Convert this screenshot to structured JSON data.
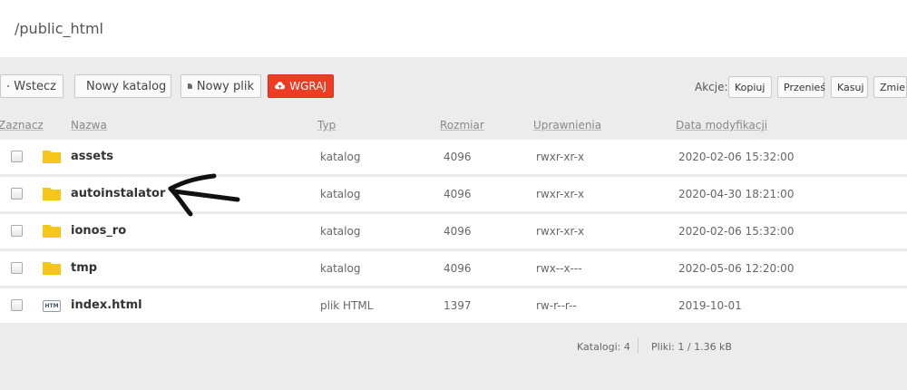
{
  "path": "/public_html",
  "toolbar": {
    "back_label": "Wstecz",
    "new_folder_label": "Nowy katalog",
    "new_file_label": "Nowy plik",
    "upload_label": "WGRAJ",
    "actions_label": "Akcje:",
    "copy_label": "Kopiuj",
    "move_label": "Przenieś",
    "delete_label": "Kasuj",
    "change_label": "Zmien"
  },
  "columns": {
    "select": "Zaznacz",
    "name": "Nazwa",
    "type": "Typ",
    "size": "Rozmiar",
    "perms": "Uprawnienia",
    "modified": "Data modyfikacji"
  },
  "files": [
    {
      "name": "assets",
      "type": "katalog",
      "size": "4096",
      "perms": "rwxr-xr-x",
      "modified": "2020-02-06 15:32:00",
      "icon": "folder-icon"
    },
    {
      "name": "autoinstalator",
      "type": "katalog",
      "size": "4096",
      "perms": "rwxr-xr-x",
      "modified": "2020-04-30 18:21:00",
      "icon": "folder-icon"
    },
    {
      "name": "ionos_ro",
      "type": "katalog",
      "size": "4096",
      "perms": "rwxr-xr-x",
      "modified": "2020-02-06 15:32:00",
      "icon": "folder-icon"
    },
    {
      "name": "tmp",
      "type": "katalog",
      "size": "4096",
      "perms": "rwx--x---",
      "modified": "2020-05-06 12:20:00",
      "icon": "folder-icon"
    },
    {
      "name": "index.html",
      "type": "plik HTML",
      "size": "1397",
      "perms": "rw-r--r--",
      "modified": "2019-10-01",
      "icon": "html-file-icon"
    }
  ],
  "html_icon_text": "HTM",
  "footer": {
    "folders": "Katalogi: 4",
    "files": "Pliki: 1 / 1.36 kB"
  },
  "colors": {
    "upload_button": "#ef3b22",
    "folder": "#f5c518",
    "background": "#ececec"
  }
}
